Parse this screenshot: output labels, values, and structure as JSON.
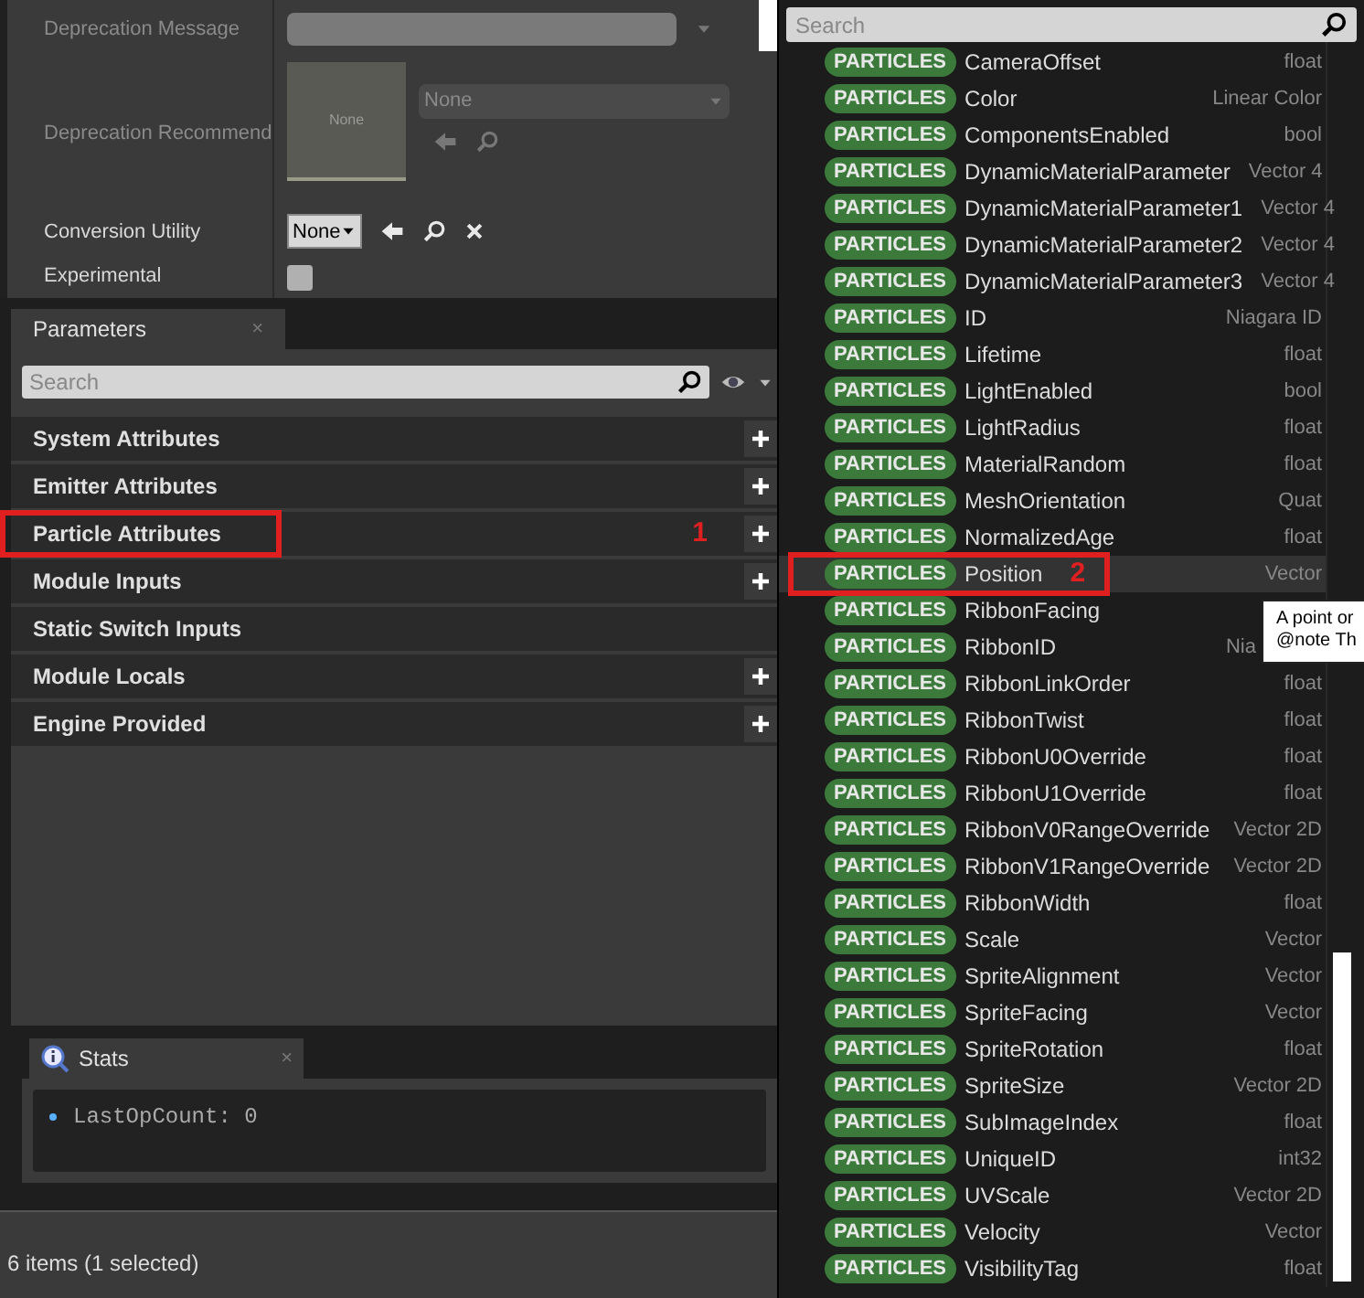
{
  "details": {
    "rows": [
      {
        "kind": "dropdown",
        "label": "Deprecation Message",
        "disabled": true
      },
      {
        "kind": "asset",
        "label": "Deprecation Recommend",
        "thumbnail": "None",
        "value": "None",
        "disabled": true
      },
      {
        "kind": "combo",
        "label": "Conversion Utility",
        "value": "None",
        "disabled": false
      },
      {
        "kind": "checkbox",
        "label": "Experimental",
        "checked": false,
        "disabled": false
      }
    ]
  },
  "parameters": {
    "tab": "Parameters",
    "close": "×",
    "search_placeholder": "Search",
    "categories": [
      {
        "label": "System Attributes",
        "addable": true
      },
      {
        "label": "Emitter Attributes",
        "addable": true
      },
      {
        "label": "Particle Attributes",
        "addable": true,
        "annotation": "1"
      },
      {
        "label": "Module Inputs",
        "addable": true
      },
      {
        "label": "Static Switch Inputs",
        "addable": false
      },
      {
        "label": "Module Locals",
        "addable": true
      },
      {
        "label": "Engine Provided",
        "addable": true
      }
    ]
  },
  "stats": {
    "tab": "Stats",
    "close": "×",
    "lines": [
      "LastOpCount: 0"
    ]
  },
  "status_bar": "6 items (1 selected)",
  "picker": {
    "search_placeholder": "Search",
    "items": [
      {
        "namespace": "PARTICLES",
        "name": "CameraOffset",
        "type": "float",
        "selected": false
      },
      {
        "namespace": "PARTICLES",
        "name": "Color",
        "type": "Linear Color",
        "selected": false
      },
      {
        "namespace": "PARTICLES",
        "name": "ComponentsEnabled",
        "type": "bool",
        "selected": false
      },
      {
        "namespace": "PARTICLES",
        "name": "DynamicMaterialParameter",
        "type": "Vector 4",
        "selected": false
      },
      {
        "namespace": "PARTICLES",
        "name": "DynamicMaterialParameter1",
        "type": "Vector 4",
        "selected": false
      },
      {
        "namespace": "PARTICLES",
        "name": "DynamicMaterialParameter2",
        "type": "Vector 4",
        "selected": false
      },
      {
        "namespace": "PARTICLES",
        "name": "DynamicMaterialParameter3",
        "type": "Vector 4",
        "selected": false
      },
      {
        "namespace": "PARTICLES",
        "name": "ID",
        "type": "Niagara ID",
        "selected": false
      },
      {
        "namespace": "PARTICLES",
        "name": "Lifetime",
        "type": "float",
        "selected": false
      },
      {
        "namespace": "PARTICLES",
        "name": "LightEnabled",
        "type": "bool",
        "selected": false
      },
      {
        "namespace": "PARTICLES",
        "name": "LightRadius",
        "type": "float",
        "selected": false
      },
      {
        "namespace": "PARTICLES",
        "name": "MaterialRandom",
        "type": "float",
        "selected": false
      },
      {
        "namespace": "PARTICLES",
        "name": "MeshOrientation",
        "type": "Quat",
        "selected": false
      },
      {
        "namespace": "PARTICLES",
        "name": "NormalizedAge",
        "type": "float",
        "selected": false
      },
      {
        "namespace": "PARTICLES",
        "name": "Position",
        "type": "Vector",
        "selected": true,
        "annotation": "2"
      },
      {
        "namespace": "PARTICLES",
        "name": "RibbonFacing",
        "selected": false,
        "tooltip": {
          "lines": [
            "A point or",
            "@note Th"
          ]
        }
      },
      {
        "namespace": "PARTICLES",
        "name": "RibbonID",
        "type": "Nia",
        "selected": false
      },
      {
        "namespace": "PARTICLES",
        "name": "RibbonLinkOrder",
        "type": "float",
        "selected": false
      },
      {
        "namespace": "PARTICLES",
        "name": "RibbonTwist",
        "type": "float",
        "selected": false
      },
      {
        "namespace": "PARTICLES",
        "name": "RibbonU0Override",
        "type": "float",
        "selected": false
      },
      {
        "namespace": "PARTICLES",
        "name": "RibbonU1Override",
        "type": "float",
        "selected": false
      },
      {
        "namespace": "PARTICLES",
        "name": "RibbonV0RangeOverride",
        "type": "Vector 2D",
        "selected": false
      },
      {
        "namespace": "PARTICLES",
        "name": "RibbonV1RangeOverride",
        "type": "Vector 2D",
        "selected": false
      },
      {
        "namespace": "PARTICLES",
        "name": "RibbonWidth",
        "type": "float",
        "selected": false
      },
      {
        "namespace": "PARTICLES",
        "name": "Scale",
        "type": "Vector",
        "selected": false
      },
      {
        "namespace": "PARTICLES",
        "name": "SpriteAlignment",
        "type": "Vector",
        "selected": false
      },
      {
        "namespace": "PARTICLES",
        "name": "SpriteFacing",
        "type": "Vector",
        "selected": false
      },
      {
        "namespace": "PARTICLES",
        "name": "SpriteRotation",
        "type": "float",
        "selected": false
      },
      {
        "namespace": "PARTICLES",
        "name": "SpriteSize",
        "type": "Vector 2D",
        "selected": false
      },
      {
        "namespace": "PARTICLES",
        "name": "SubImageIndex",
        "type": "float",
        "selected": false
      },
      {
        "namespace": "PARTICLES",
        "name": "UniqueID",
        "type": "int32",
        "selected": false
      },
      {
        "namespace": "PARTICLES",
        "name": "UVScale",
        "type": "Vector 2D",
        "selected": false
      },
      {
        "namespace": "PARTICLES",
        "name": "Velocity",
        "type": "Vector",
        "selected": false
      },
      {
        "namespace": "PARTICLES",
        "name": "VisibilityTag",
        "type": "float",
        "selected": false
      }
    ]
  }
}
